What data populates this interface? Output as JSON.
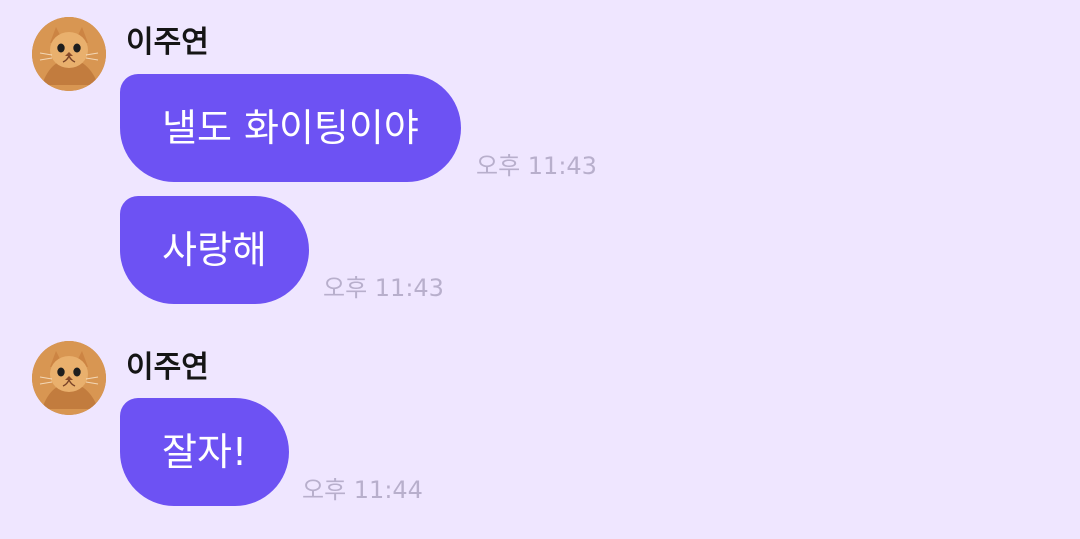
{
  "background_color": "#efe6ff",
  "bubble_color": "#6d52f3",
  "groups": [
    {
      "sender_name": "이주연",
      "avatar_icon": "cat-avatar-icon",
      "messages": [
        {
          "text": "낼도 화이팅이야",
          "time": "오후 11:43"
        },
        {
          "text": "사랑해",
          "time": "오후 11:43"
        }
      ]
    },
    {
      "sender_name": "이주연",
      "avatar_icon": "cat-avatar-icon",
      "messages": [
        {
          "text": "잘자!",
          "time": "오후 11:44"
        }
      ]
    }
  ]
}
